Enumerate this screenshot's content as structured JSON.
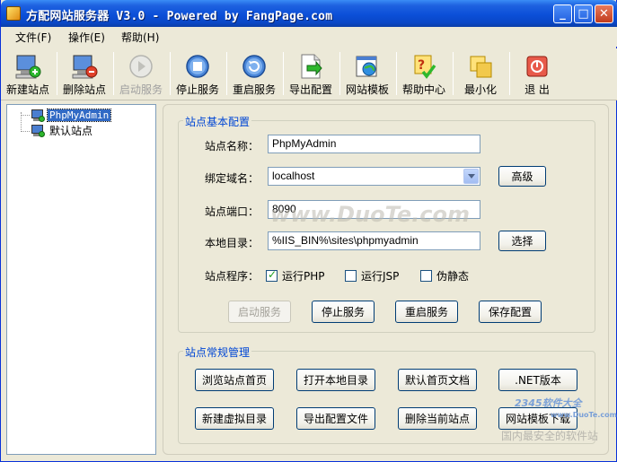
{
  "window": {
    "title": "方配网站服务器 V3.0 - Powered by FangPage.com",
    "controls": {
      "minimize": "_",
      "maximize": "□",
      "close": "✕"
    }
  },
  "menu": [
    "文件(F)",
    "操作(E)",
    "帮助(H)"
  ],
  "toolbar": [
    {
      "label": "新建站点",
      "icon": "new-site-icon",
      "enabled": true
    },
    {
      "label": "删除站点",
      "icon": "delete-site-icon",
      "enabled": true
    },
    {
      "label": "启动服务",
      "icon": "play-icon",
      "enabled": false
    },
    {
      "label": "停止服务",
      "icon": "stop-icon",
      "enabled": true
    },
    {
      "label": "重启服务",
      "icon": "restart-icon",
      "enabled": true
    },
    {
      "label": "导出配置",
      "icon": "export-icon",
      "enabled": true
    },
    {
      "label": "网站模板",
      "icon": "template-icon",
      "enabled": true
    },
    {
      "label": "帮助中心",
      "icon": "help-icon",
      "enabled": true
    },
    {
      "label": "最小化",
      "icon": "minimize-icon",
      "enabled": true
    },
    {
      "label": "退 出",
      "icon": "exit-icon",
      "enabled": true
    }
  ],
  "tree": [
    {
      "label": "PhpMyAdmin",
      "selected": true
    },
    {
      "label": "默认站点",
      "selected": false
    }
  ],
  "basic_config": {
    "title": "站点基本配置",
    "site_name_label": "站点名称：",
    "site_name": "PhpMyAdmin",
    "domain_label": "绑定域名：",
    "domain": "localhost",
    "advanced_button": "高级",
    "port_label": "站点端口：",
    "port": "8090",
    "dir_label": "本地目录：",
    "dir": "%IIS_BIN%\\sites\\phpmyadmin",
    "browse_button": "选择",
    "program_label": "站点程序：",
    "checkboxes": [
      {
        "label": "运行PHP",
        "checked": true
      },
      {
        "label": "运行JSP",
        "checked": false
      },
      {
        "label": "伪静态",
        "checked": false
      }
    ],
    "buttons": [
      {
        "label": "启动服务",
        "enabled": false
      },
      {
        "label": "停止服务",
        "enabled": true
      },
      {
        "label": "重启服务",
        "enabled": true
      },
      {
        "label": "保存配置",
        "enabled": true
      }
    ]
  },
  "routine": {
    "title": "站点常规管理",
    "buttons": [
      "浏览站点首页",
      "打开本地目录",
      "默认首页文档",
      ".NET版本",
      "新建虚拟目录",
      "导出配置文件",
      "删除当前站点",
      "网站模板下载"
    ]
  },
  "watermarks": {
    "center": "www.DuoTe.com",
    "corner_logo": "2345软件大全",
    "corner_url": "www.DuoTe.com",
    "corner_slogan": "国内最安全的软件站"
  },
  "colors": {
    "title_bar": "#0b4fd8",
    "group_title": "#0046d5",
    "selection": "#316ac5",
    "face": "#ece9d8"
  }
}
